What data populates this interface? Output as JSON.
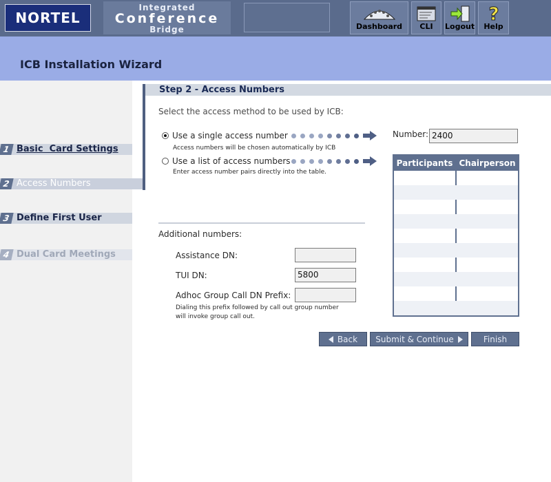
{
  "header": {
    "logo": "NORTEL",
    "product_line1": "Integrated",
    "product_line2": "Conference",
    "product_line3": "Bridge",
    "nav": [
      {
        "label": "Dashboard",
        "icon": "dashboard-icon"
      },
      {
        "label": "CLI",
        "icon": "cli-icon"
      },
      {
        "label": "Logout",
        "icon": "logout-icon"
      },
      {
        "label": "Help",
        "icon": "help-icon"
      }
    ]
  },
  "banner": {
    "title": "ICB Installation Wizard"
  },
  "sidebar": {
    "steps": [
      {
        "num": "1",
        "label": "Basic  Card Settings"
      },
      {
        "num": "2",
        "label": "Access Numbers"
      },
      {
        "num": "3",
        "label": "Define First User"
      },
      {
        "num": "4",
        "label": "Dual Card Meetings"
      }
    ]
  },
  "main": {
    "step_title": "Step 2 - Access Numbers",
    "prompt": "Select the access method to be used by ICB:",
    "single": {
      "label": "Use a single access number",
      "desc": "Access numbers will be chosen automatically by ICB",
      "selected": true
    },
    "list": {
      "label": "Use a list of access numbers",
      "desc": "Enter access number pairs directly into the table.",
      "selected": false
    },
    "number_label": "Number:",
    "number_value": "2400",
    "table": {
      "headers": [
        "Participants",
        "Chairperson"
      ],
      "row_count": 10
    },
    "additional_label": "Additional numbers:",
    "assistance_label": "Assistance DN:",
    "assistance_value": "",
    "tui_label": "TUI DN:",
    "tui_value": "5800",
    "adhoc_label": "Adhoc Group Call DN Prefix:",
    "adhoc_value": "",
    "adhoc_desc_1": "Dialing this prefix followed by call out group number",
    "adhoc_desc_2": "will invoke group call out."
  },
  "buttons": {
    "back": "Back",
    "submit": "Submit & Continue",
    "finish": "Finish"
  },
  "colors": {
    "header_bg": "#5a6b8c",
    "logo_bg": "#1a2e7a",
    "banner_bg": "#9aace6",
    "accent": "#5f708f"
  }
}
